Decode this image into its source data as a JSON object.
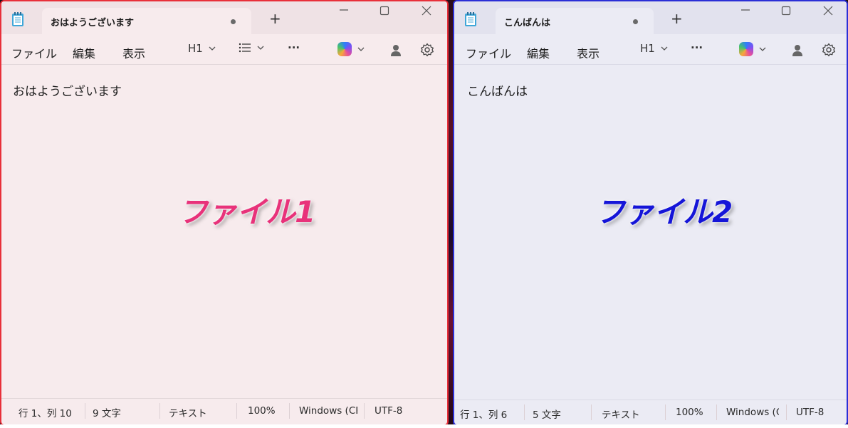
{
  "window1": {
    "tab_title": "おはようございます",
    "menu": {
      "file": "ファイル",
      "edit": "編集",
      "view": "表示"
    },
    "toolbar": {
      "heading": "H1"
    },
    "content": "おはようございます",
    "overlay": "ファイル1",
    "status": {
      "position": "行 1、列 10",
      "chars": "9 文字",
      "mode": "テキスト",
      "zoom": "100%",
      "eol": "Windows (CR",
      "encoding": "UTF-8"
    },
    "colors": {
      "border": "#e8303a",
      "background": "#f7ebed",
      "overlay": "#e8327a"
    }
  },
  "window2": {
    "tab_title": "こんばんは",
    "menu": {
      "file": "ファイル",
      "edit": "編集",
      "view": "表示"
    },
    "toolbar": {
      "heading": "H1"
    },
    "content": "こんばんは",
    "overlay": "ファイル2",
    "status": {
      "position": "行 1、列 6",
      "chars": "5 文字",
      "mode": "テキスト",
      "zoom": "100%",
      "eol": "Windows (C",
      "encoding": "UTF-8"
    },
    "colors": {
      "border": "#2b2fd6",
      "background": "#ebebf4",
      "overlay": "#1515d8"
    }
  },
  "glyphs": {
    "new_tab": "+",
    "more": "···",
    "minimize": "—",
    "maximize": "☐",
    "close": "✕",
    "chevron": "⌄",
    "list": "☰"
  },
  "icons": [
    "notepad-icon",
    "copilot-icon",
    "account-icon",
    "gear-icon",
    "list-icon",
    "chevron-down-icon"
  ]
}
